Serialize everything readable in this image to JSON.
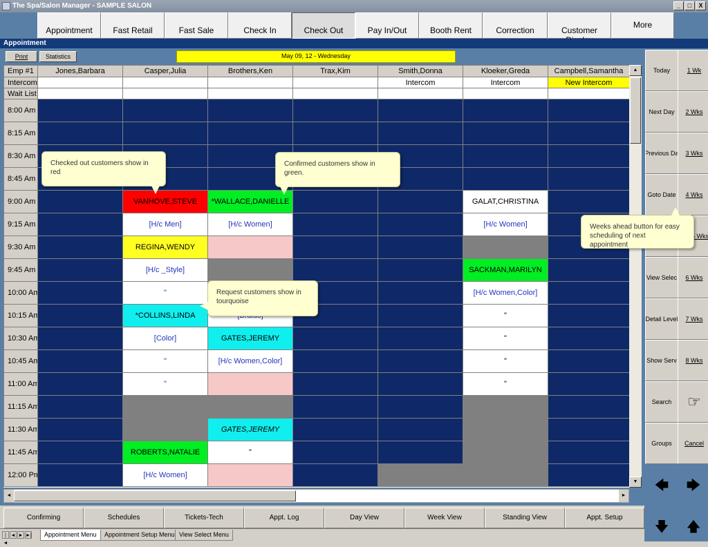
{
  "window": {
    "title": "The Spa/Salon Manager - SAMPLE SALON",
    "minimize": "_",
    "restore": "□",
    "close": "X"
  },
  "nav": {
    "appointment": "Appointment",
    "fast_retail": "Fast Retail",
    "fast_sale": "Fast Sale",
    "check_in": "Check In",
    "check_out": "Check Out",
    "pay_in_out": "Pay In/Out",
    "booth_rent": "Booth Rent",
    "correction": "Correction",
    "customer_display": "Customer Display",
    "more": "More"
  },
  "section_title": "Appointment",
  "toolbar": {
    "print": "Print",
    "statistics": "Statistics"
  },
  "date": "May 09, 12 - Wednesday",
  "grid": {
    "emp_label": "Emp #1",
    "employees": [
      "Jones,Barbara",
      "Casper,Julia",
      "Brothers,Ken",
      "Trax,Kim",
      "Smith,Donna",
      "Kloeker,Greda",
      "Campbell,Samantha"
    ],
    "intercom_label": "Intercom",
    "intercom": [
      "",
      "",
      "",
      "",
      "Intercom",
      "Intercom",
      "New Intercom"
    ],
    "waitlist_label": "Wait List",
    "times": [
      "8:00 Am",
      "8:15 Am",
      "8:30 Am",
      "8:45 Am",
      "9:00 Am",
      "9:15 Am",
      "9:30 Am",
      "9:45 Am",
      "10:00 Am",
      "10:15 Am",
      "10:30 Am",
      "10:45 Am",
      "11:00 Am",
      "11:15 Am",
      "11:30 Am",
      "11:45 Am",
      "12:00 Pm"
    ],
    "cells": [
      [
        [
          "navy",
          ""
        ],
        [
          "navy",
          ""
        ],
        [
          "navy",
          ""
        ],
        [
          "navy",
          ""
        ],
        [
          "navy",
          ""
        ],
        [
          "navy",
          ""
        ],
        [
          "navy",
          ""
        ]
      ],
      [
        [
          "navy",
          ""
        ],
        [
          "navy",
          ""
        ],
        [
          "navy",
          ""
        ],
        [
          "navy",
          ""
        ],
        [
          "navy",
          ""
        ],
        [
          "navy",
          ""
        ],
        [
          "navy",
          ""
        ]
      ],
      [
        [
          "navy",
          ""
        ],
        [
          "navy",
          ""
        ],
        [
          "navy",
          ""
        ],
        [
          "navy",
          ""
        ],
        [
          "navy",
          ""
        ],
        [
          "navy",
          ""
        ],
        [
          "navy",
          ""
        ]
      ],
      [
        [
          "navy",
          ""
        ],
        [
          "navy",
          ""
        ],
        [
          "navy",
          ""
        ],
        [
          "navy",
          ""
        ],
        [
          "navy",
          ""
        ],
        [
          "navy",
          ""
        ],
        [
          "navy",
          ""
        ]
      ],
      [
        [
          "navy",
          ""
        ],
        [
          "red",
          "VANHOVE,STEVE"
        ],
        [
          "green",
          "*WALLACE,DANIELLE"
        ],
        [
          "navy",
          ""
        ],
        [
          "navy",
          ""
        ],
        [
          "white",
          "GALAT,CHRISTINA"
        ],
        [
          "navy",
          ""
        ]
      ],
      [
        [
          "navy",
          ""
        ],
        [
          "white blue",
          "[H/c Men]"
        ],
        [
          "white blue",
          "[H/c Women]"
        ],
        [
          "navy",
          ""
        ],
        [
          "navy",
          ""
        ],
        [
          "white blue",
          "[H/c Women]"
        ],
        [
          "navy",
          ""
        ]
      ],
      [
        [
          "navy",
          ""
        ],
        [
          "yellow",
          "REGINA,WENDY"
        ],
        [
          "pink",
          ""
        ],
        [
          "navy",
          ""
        ],
        [
          "navy",
          ""
        ],
        [
          "gray",
          ""
        ],
        [
          "navy",
          ""
        ]
      ],
      [
        [
          "navy",
          ""
        ],
        [
          "white blue",
          "[H/c _Style]"
        ],
        [
          "gray",
          ""
        ],
        [
          "navy",
          ""
        ],
        [
          "navy",
          ""
        ],
        [
          "green",
          "SACKMAN,MARILYN"
        ],
        [
          "navy",
          ""
        ]
      ],
      [
        [
          "navy",
          ""
        ],
        [
          "white blue",
          "\""
        ],
        [
          "white",
          ""
        ],
        [
          "navy",
          ""
        ],
        [
          "navy",
          ""
        ],
        [
          "white blue",
          "[H/c Women,Color]"
        ],
        [
          "navy",
          ""
        ]
      ],
      [
        [
          "navy",
          ""
        ],
        [
          "cyan",
          "*COLLINS,LINDA"
        ],
        [
          "white blue",
          "[Braids]"
        ],
        [
          "navy",
          ""
        ],
        [
          "navy",
          ""
        ],
        [
          "white",
          "\""
        ],
        [
          "navy",
          ""
        ]
      ],
      [
        [
          "navy",
          ""
        ],
        [
          "white blue",
          "[Color]"
        ],
        [
          "cyan",
          "GATES,JEREMY"
        ],
        [
          "navy",
          ""
        ],
        [
          "navy",
          ""
        ],
        [
          "white",
          "\""
        ],
        [
          "navy",
          ""
        ]
      ],
      [
        [
          "navy",
          ""
        ],
        [
          "white blue",
          "\""
        ],
        [
          "white blue",
          "[H/c Women,Color]"
        ],
        [
          "navy",
          ""
        ],
        [
          "navy",
          ""
        ],
        [
          "white",
          "\""
        ],
        [
          "navy",
          ""
        ]
      ],
      [
        [
          "navy",
          ""
        ],
        [
          "white blue",
          "\""
        ],
        [
          "pink",
          ""
        ],
        [
          "navy",
          ""
        ],
        [
          "navy",
          ""
        ],
        [
          "white",
          "\""
        ],
        [
          "navy",
          ""
        ]
      ],
      [
        [
          "navy",
          ""
        ],
        [
          "gray",
          ""
        ],
        [
          "gray",
          ""
        ],
        [
          "navy",
          ""
        ],
        [
          "navy",
          ""
        ],
        [
          "gray",
          ""
        ],
        [
          "navy",
          ""
        ]
      ],
      [
        [
          "navy",
          ""
        ],
        [
          "gray",
          ""
        ],
        [
          "cyan ital",
          "GATES,JEREMY"
        ],
        [
          "navy",
          ""
        ],
        [
          "navy",
          ""
        ],
        [
          "gray",
          ""
        ],
        [
          "navy",
          ""
        ]
      ],
      [
        [
          "navy",
          ""
        ],
        [
          "green",
          "ROBERTS,NATALIE"
        ],
        [
          "white",
          "\""
        ],
        [
          "navy",
          ""
        ],
        [
          "navy",
          ""
        ],
        [
          "gray",
          ""
        ],
        [
          "navy",
          ""
        ]
      ],
      [
        [
          "navy",
          ""
        ],
        [
          "white blue",
          "[H/c Women]"
        ],
        [
          "pink",
          ""
        ],
        [
          "navy",
          ""
        ],
        [
          "gray",
          ""
        ],
        [
          "gray",
          ""
        ],
        [
          "navy",
          ""
        ]
      ]
    ]
  },
  "right_panel": {
    "today": "Today",
    "wk1": "1 Wk",
    "next_day": "Next Day",
    "wks2": "2 Wks",
    "previous_day": "Previous Da",
    "wks3": "3 Wks",
    "goto_date": "Goto Date",
    "wks4": "4 Wks",
    "wks5": "5 Wks",
    "view_select": "View Selec",
    "wks6": "6 Wks",
    "detail_level": "Detail Level",
    "wks7": "7 Wks",
    "show_serv": "Show Serv",
    "wks8": "8 Wks",
    "search": "Search",
    "hand_icon": "☞",
    "groups": "Groups",
    "cancel": "Cancel"
  },
  "bottom": {
    "confirming": "Confirming",
    "schedules": "Schedules",
    "tickets_tech": "Tickets-Tech",
    "appt_log": "Appt. Log",
    "day_view": "Day View",
    "week_view": "Week View",
    "standing_view": "Standing View",
    "appt_setup": "Appt. Setup"
  },
  "tabs": [
    "Appointment Menu",
    "Appointment Setup Menu",
    "View Select Menu"
  ],
  "callouts": {
    "checked_out": "Checked out customers show in red",
    "confirmed": "Confirmed customers show in green.",
    "request": "Request customers show in tourquoise",
    "weeks_ahead": "Weeks ahead button for easy scheduling of next appointment"
  }
}
